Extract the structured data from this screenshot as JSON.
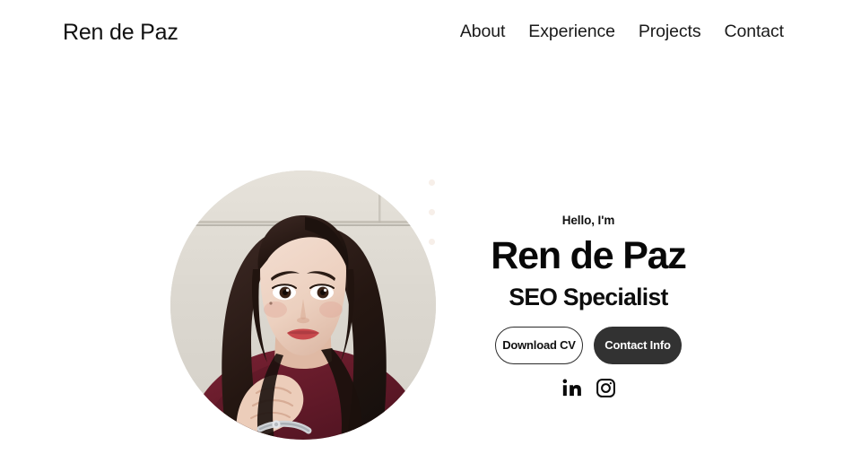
{
  "header": {
    "brand": "Ren de Paz",
    "nav": [
      {
        "label": "About"
      },
      {
        "label": "Experience"
      },
      {
        "label": "Projects"
      },
      {
        "label": "Contact"
      }
    ]
  },
  "hero": {
    "greeting": "Hello, I'm",
    "name": "Ren de Paz",
    "role": "SEO Specialist",
    "photo_alt": "Portrait photo of Ren de Paz",
    "buttons": {
      "download_cv": "Download CV",
      "contact_info": "Contact Info"
    },
    "socials": [
      {
        "name": "linkedin",
        "icon": "linkedin-icon"
      },
      {
        "name": "instagram",
        "icon": "instagram-icon"
      }
    ],
    "decorative_dots": 3
  },
  "theme": {
    "background": "#ffffff",
    "text": "#111111",
    "button_solid_bg": "#323232",
    "button_solid_text": "#ffffff",
    "button_outline_border": "#2b2b2b",
    "decorative_dot": "#f7efe9"
  }
}
